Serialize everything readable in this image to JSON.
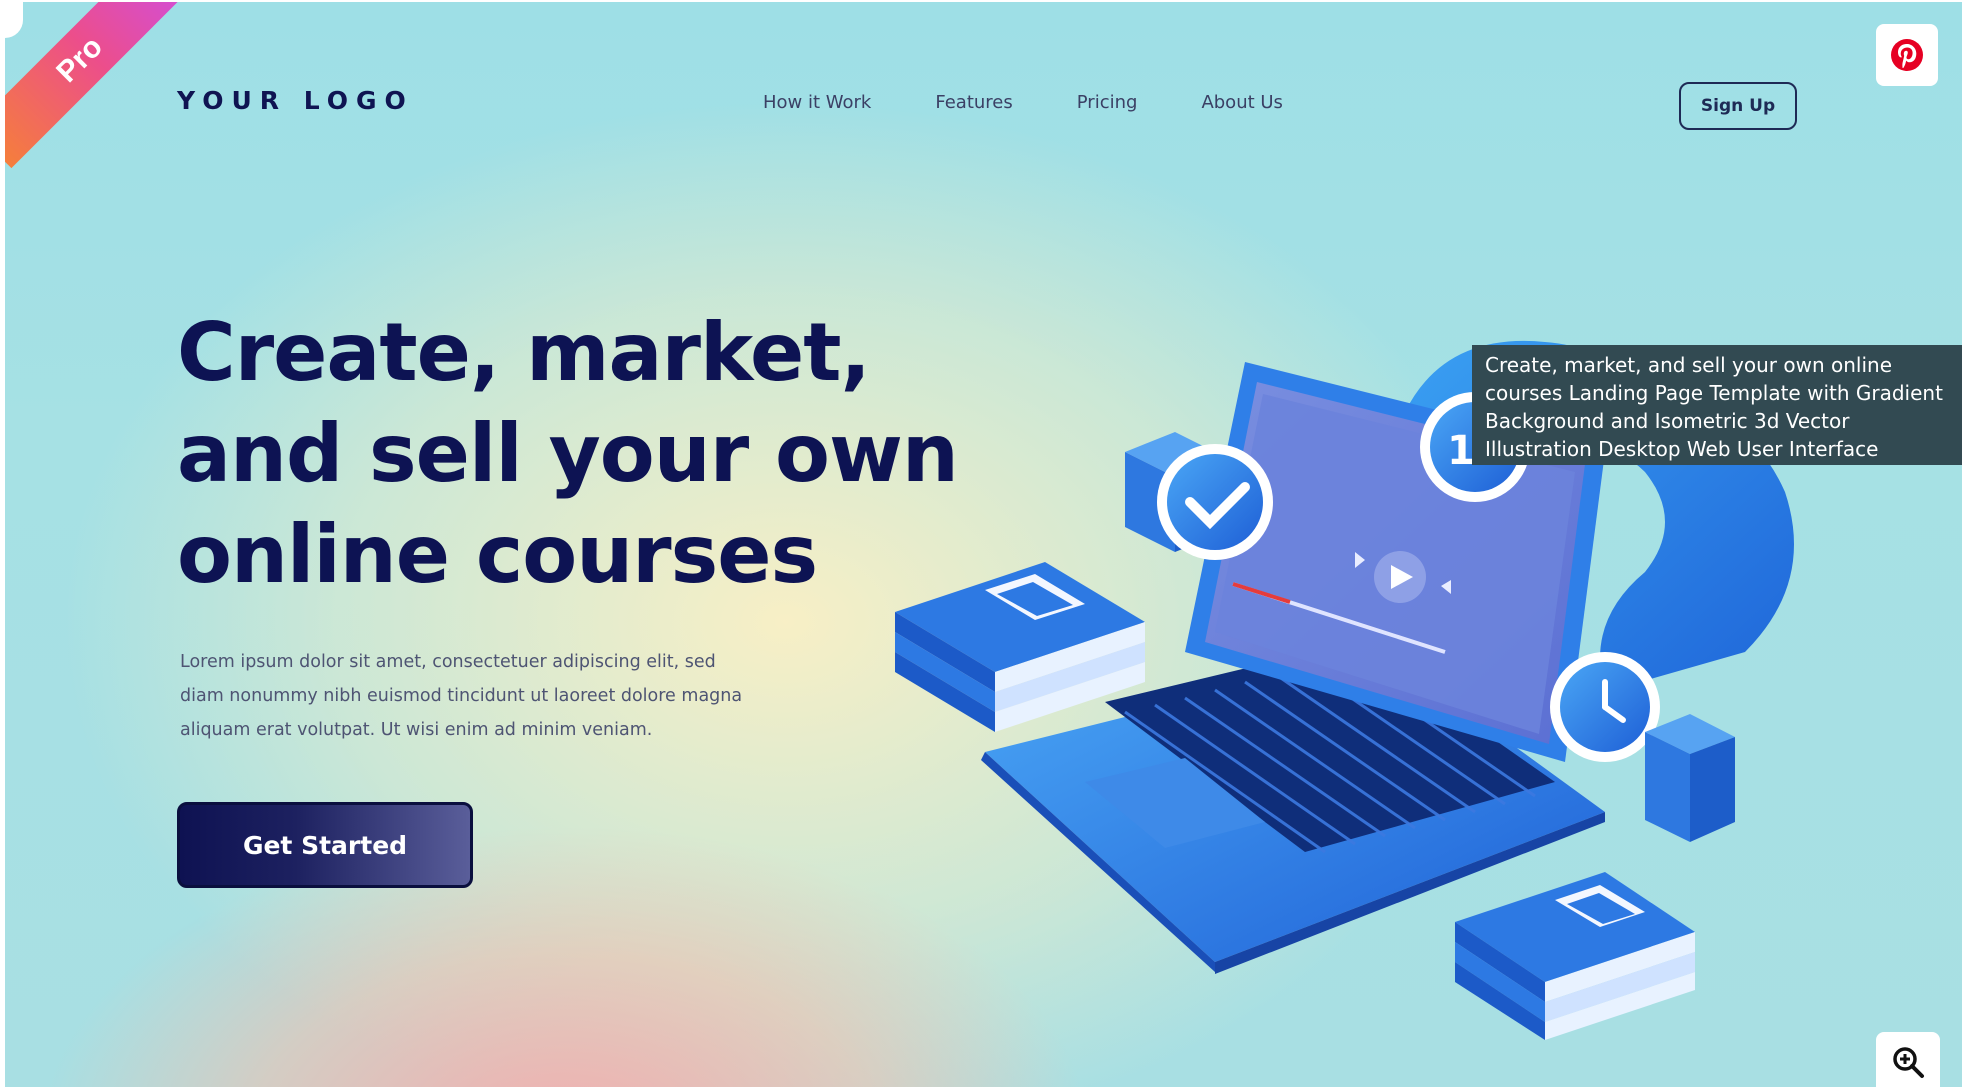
{
  "badge": {
    "label": "Pro"
  },
  "header": {
    "logo": "YOUR LOGO",
    "nav": [
      "How it Work",
      "Features",
      "Pricing",
      "About Us"
    ],
    "signup_label": "Sign Up"
  },
  "hero": {
    "headline_lines": [
      "Create, market,",
      "and sell your own",
      "online courses"
    ],
    "body_lines": [
      "Lorem ipsum dolor sit amet, consectetuer adipiscing elit, sed",
      "diam nonummy nibh euismod tincidunt ut laoreet dolore magna",
      "aliquam erat volutpat. Ut wisi enim ad minim veniam."
    ],
    "cta_label": "Get Started"
  },
  "illustration": {
    "calendar_number": "15"
  },
  "tooltip": {
    "lines": [
      "Create, market, and sell your own online",
      "courses Landing Page Template with Gradient",
      "Background and Isometric 3d Vector",
      "Illustration Desktop Web User Interface"
    ]
  },
  "overlay_icons": {
    "pinterest": "pinterest-icon",
    "zoom": "zoom-in-icon"
  },
  "colors": {
    "navy": "#0d1353",
    "pinterest_red": "#e60023",
    "ribbon_start": "#f57e3c",
    "ribbon_end": "#d24ed9",
    "tooltip_bg": "#324a52"
  }
}
